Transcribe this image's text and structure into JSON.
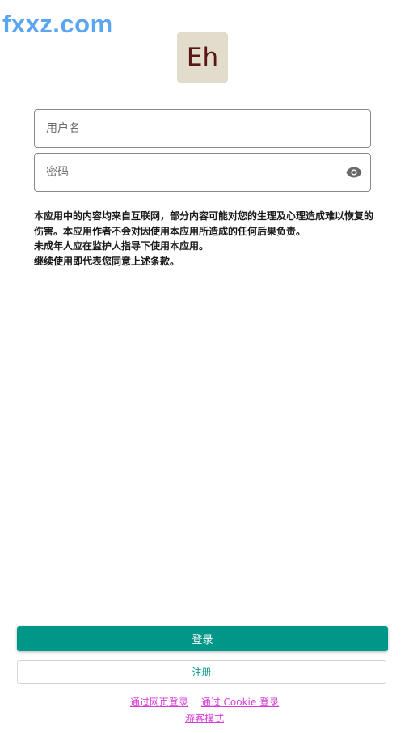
{
  "watermark": {
    "text": "fxxz.com",
    "color": "#5aa6f0"
  },
  "logo": {
    "text": "Eh",
    "background": "#e1dccc",
    "text_color": "#5a1616"
  },
  "form": {
    "username_placeholder": "用户名",
    "password_placeholder": "密码",
    "password_toggle_icon": "eye-icon"
  },
  "notice": {
    "lines": [
      "本应用中的内容均来自互联网，部分内容可能对您的生理及心理造成难以恢复的伤害。本应用作者不会对因使用本应用所造成的任何后果负责。",
      "未成年人应在监护人指导下使用本应用。",
      "继续使用即代表您同意上述条款。"
    ]
  },
  "actions": {
    "login_label": "登录",
    "register_label": "注册",
    "web_login_label": "通过网页登录",
    "cookie_login_label": "通过 Cookie 登录",
    "guest_mode_label": "游客模式"
  },
  "colors": {
    "primary": "#009688",
    "link": "#d63fd6",
    "icon": "#6a6a6a"
  }
}
